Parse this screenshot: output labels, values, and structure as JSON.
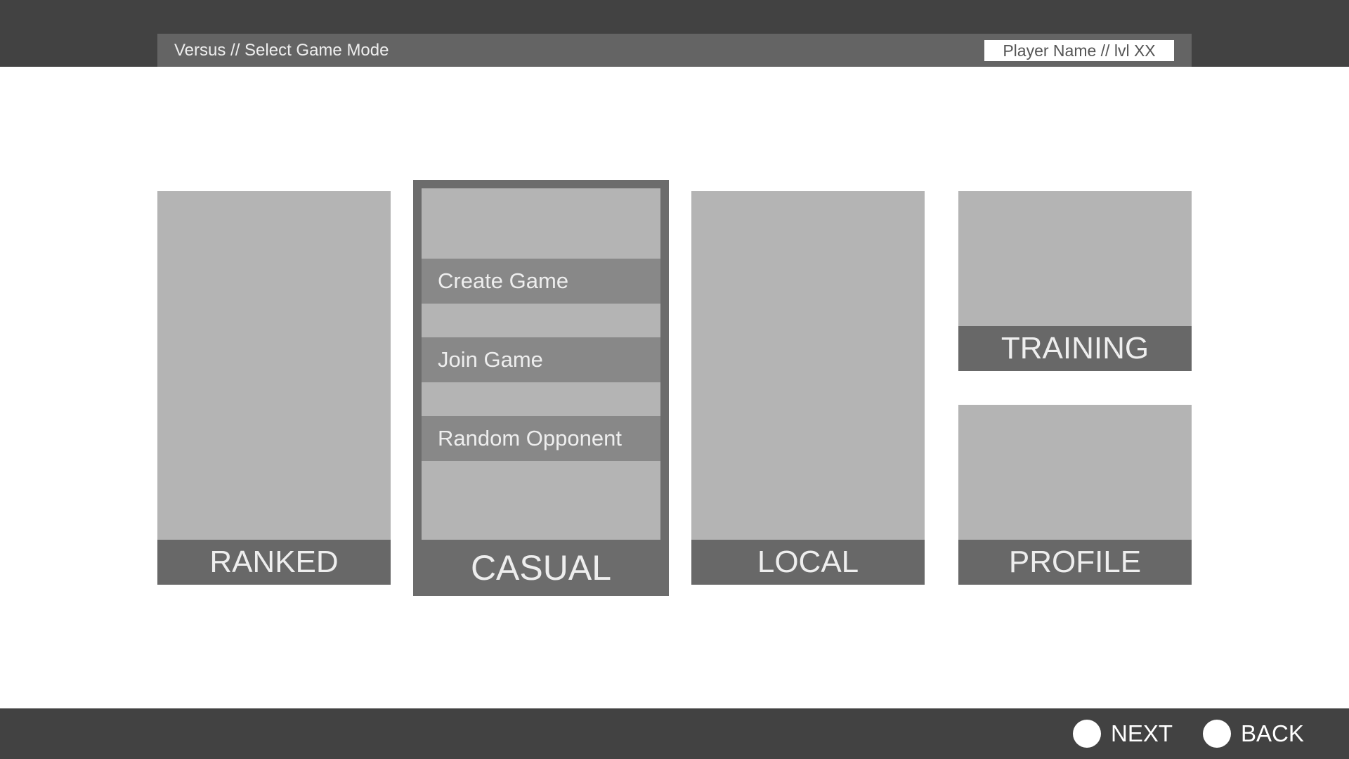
{
  "header": {
    "breadcrumb": "Versus // Select Game Mode",
    "player": "Player Name // lvl XX"
  },
  "modes": {
    "ranked": "RANKED",
    "casual": {
      "label": "CASUAL",
      "options": [
        "Create Game",
        "Join Game",
        "Random Opponent"
      ]
    },
    "local": "LOCAL",
    "training": "TRAINING",
    "profile": "PROFILE"
  },
  "footer": {
    "next": "NEXT",
    "back": "BACK"
  },
  "colors": {
    "band": "#424242",
    "header_bar": "#646464",
    "card": "#b4b4b4",
    "card_label": "#686868",
    "selected_frame": "#6c6c6c",
    "option": "#888888"
  }
}
